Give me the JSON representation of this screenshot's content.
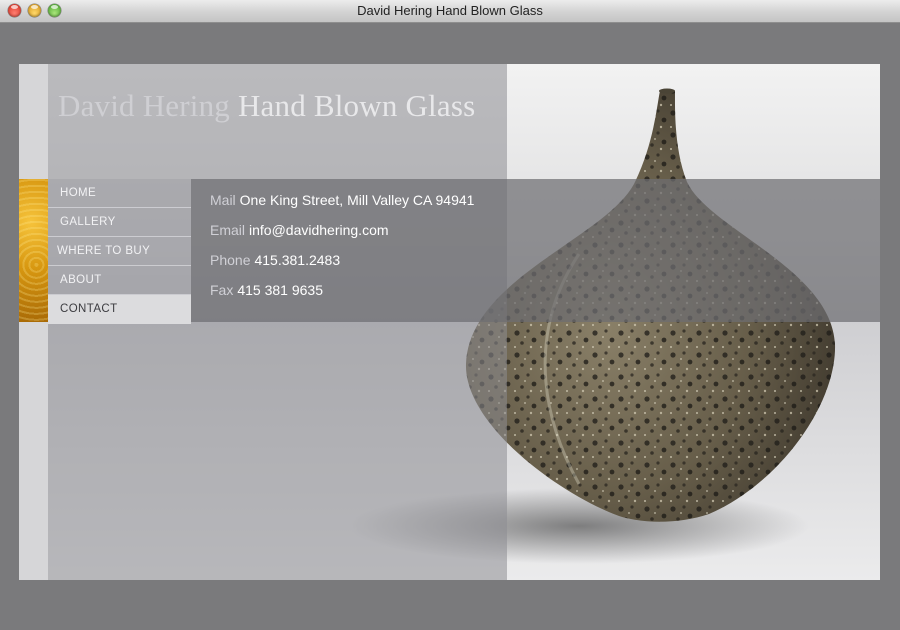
{
  "window": {
    "title": "David Hering Hand Blown Glass"
  },
  "site": {
    "title_light": "David Hering",
    "title_rest": " Hand Blown Glass"
  },
  "nav": {
    "items": [
      {
        "label": "HOME"
      },
      {
        "label": "GALLERY"
      },
      {
        "label": "WHERE TO BUY"
      },
      {
        "label": "ABOUT"
      },
      {
        "label": "CONTACT",
        "active": true
      }
    ]
  },
  "contact": {
    "mail_label": "Mail",
    "mail_value": "One King Street, Mill Valley CA 94941",
    "email_label": "Email",
    "email_value": "info@davidhering.com",
    "phone_label": "Phone",
    "phone_value": "415.381.2483",
    "fax_label": "Fax",
    "fax_value": "415 381 9635"
  },
  "colors": {
    "page_bg": "#7a7a7c",
    "accent_swatch": "#d89811",
    "vase": "#6e6552"
  }
}
